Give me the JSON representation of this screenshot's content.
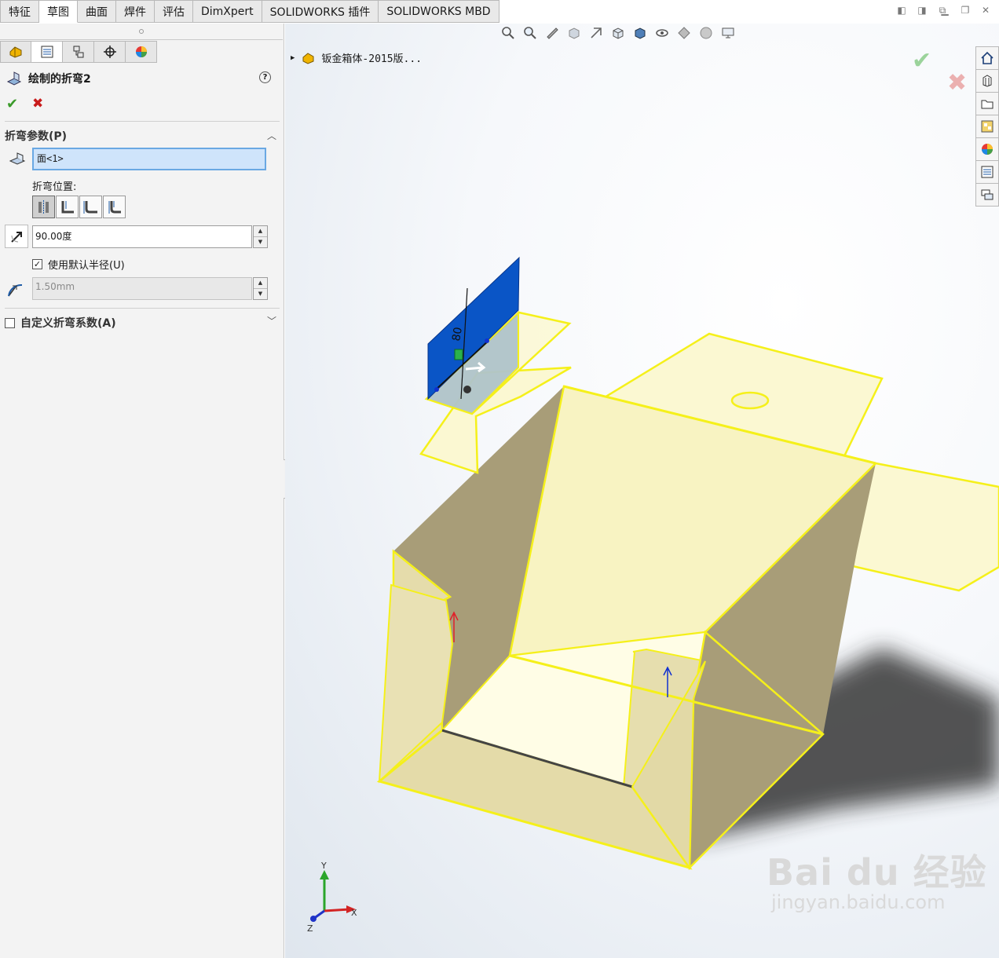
{
  "tabs": [
    {
      "label": "特征",
      "active": false
    },
    {
      "label": "草图",
      "active": true
    },
    {
      "label": "曲面",
      "active": false
    },
    {
      "label": "焊件",
      "active": false
    },
    {
      "label": "评估",
      "active": false
    },
    {
      "label": "DimXpert",
      "active": false
    },
    {
      "label": "SOLIDWORKS 插件",
      "active": false
    },
    {
      "label": "SOLIDWORKS MBD",
      "active": false
    }
  ],
  "panel_tabs": [
    "feature-manager-icon",
    "property-manager-icon",
    "configuration-manager-icon",
    "dimxpert-manager-icon",
    "display-manager-icon"
  ],
  "feature": {
    "title": "绘制的折弯2",
    "help": "?"
  },
  "bend_params": {
    "header": "折弯参数(P)",
    "face_value": "面<1>",
    "position_label": "折弯位置:",
    "position_options": [
      "bend-centerline-icon",
      "material-inside-icon",
      "material-outside-icon",
      "bend-outside-icon"
    ],
    "angle_value": "90.00度",
    "use_default_radius_label": "使用默认半径(U)",
    "use_default_radius_checked": true,
    "radius_value": "1.50mm"
  },
  "custom_bend": {
    "label": "自定义折弯系数(A)",
    "checked": false
  },
  "viewport": {
    "tree_item": "钣金箱体-2015版..."
  },
  "triad": {
    "x": "X",
    "y": "Y",
    "z": "Z"
  },
  "watermark": {
    "main": "Bai  du 经验",
    "sub": "jingyan.baidu.com"
  },
  "colors": {
    "highlight": "#f5f01a",
    "face_fill": "#fbf8d2",
    "inner_wall": "#a89d78",
    "selected_face": "#0a55c6",
    "ok_green": "#3a9a2a",
    "cancel_red": "#c81b1b"
  }
}
